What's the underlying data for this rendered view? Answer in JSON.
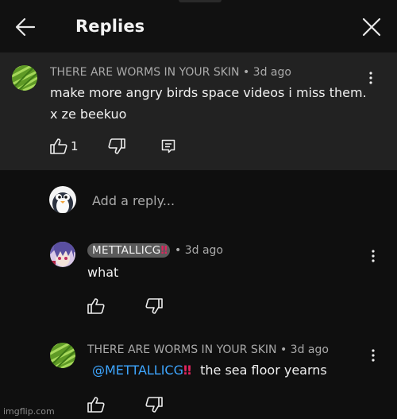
{
  "header": {
    "title": "Replies",
    "back_icon": "arrow-left-icon",
    "close_icon": "close-icon"
  },
  "original_comment": {
    "author": "THERE ARE WORMS IN YOUR SKIN",
    "time": "• 3d ago",
    "lines": [
      "make more angry birds space videos i miss them.",
      "x ze beekuo"
    ],
    "like_count": "1",
    "avatar": "green-grass-avatar"
  },
  "reply_input": {
    "placeholder": "Add a reply...",
    "avatar": "penguin-avatar"
  },
  "replies": [
    {
      "author": "METTALLICG",
      "author_badge": "‼",
      "time": "• 3d ago",
      "text": "what",
      "avatar": "anime-character-avatar"
    },
    {
      "author": "THERE ARE WORMS IN YOUR SKIN",
      "time": "• 3d ago",
      "mention": "@METTALLICG",
      "mention_badge": "‼",
      "text": "the sea floor yearns",
      "avatar": "green-grass-avatar"
    }
  ],
  "watermark": "imgflip.com",
  "colors": {
    "background": "#0f0f0f",
    "highlight": "#222222",
    "mention": "#3ea6ff",
    "badge": "#e0245e"
  }
}
